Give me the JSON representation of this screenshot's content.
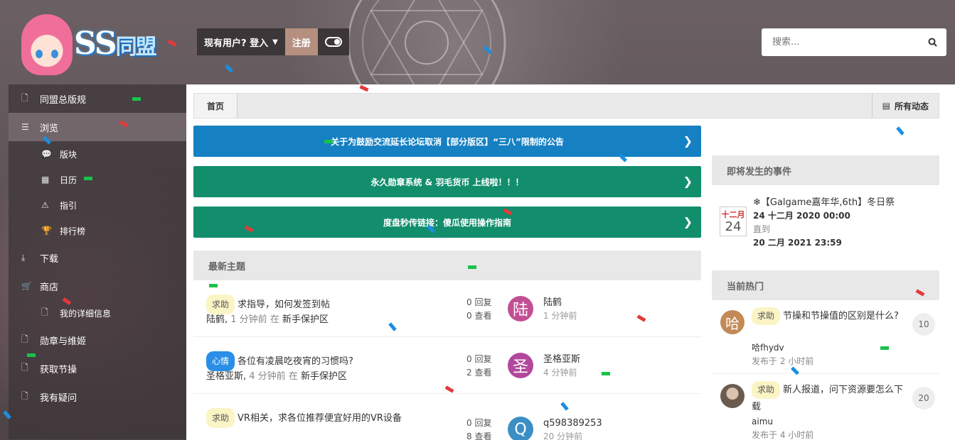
{
  "brand": {
    "logo_text": "SS",
    "logo_subtext": "同盟"
  },
  "header": {
    "login_label": "现有用户? 登入",
    "register_label": "注册",
    "search_placeholder": "搜索..."
  },
  "sidebar": {
    "items": [
      {
        "label": "同盟总版规",
        "icon": "document-icon"
      },
      {
        "label": "浏览",
        "icon": "list-icon"
      },
      {
        "label": "版块",
        "icon": "chat-icon"
      },
      {
        "label": "日历",
        "icon": "calendar-icon"
      },
      {
        "label": "指引",
        "icon": "warning-icon"
      },
      {
        "label": "排行榜",
        "icon": "trophy-icon"
      },
      {
        "label": "下载",
        "icon": "download-icon"
      },
      {
        "label": "商店",
        "icon": "cart-icon"
      },
      {
        "label": "我的详细信息",
        "icon": "document-icon"
      },
      {
        "label": "勋章与维姬",
        "icon": "document-icon"
      },
      {
        "label": "获取节操",
        "icon": "document-icon"
      },
      {
        "label": "我有疑问",
        "icon": "document-icon"
      }
    ]
  },
  "breadcrumb": {
    "home": "首页",
    "all_activity": "所有动态"
  },
  "banners": [
    {
      "text": "关于为鼓励交流延长论坛取消【部分版区】“三八”限制的公告",
      "color": "#1580c2"
    },
    {
      "text": "永久勋章系统 & 羽毛货币 上线啦！！！",
      "color": "#128e6d"
    },
    {
      "text": "度盘秒传链接：傻瓜使用操作指南",
      "color": "#128e6d"
    }
  ],
  "latest": {
    "title": "最新主题",
    "topics": [
      {
        "tag": "求助",
        "tag_type": "help",
        "title": "求指导，如何发签到帖",
        "author": "陆鹤",
        "time": "1 分钟前",
        "in": "在",
        "forum": "新手保护区",
        "replies": "0 回复",
        "views": "0 查看",
        "avatar_char": "陆",
        "avatar_color": "#c24f94",
        "last_user": "陆鹤",
        "last_time": "1 分钟前"
      },
      {
        "tag": "心情",
        "tag_type": "heart",
        "title": "各位有凌晨吃夜宵的习惯吗?",
        "author": "圣格亚斯",
        "time": "4 分钟前",
        "in": "在",
        "forum": "新手保护区",
        "replies": "0 回复",
        "views": "2 查看",
        "avatar_char": "圣",
        "avatar_color": "#b2479c",
        "last_user": "圣格亚斯",
        "last_time": "4 分钟前"
      },
      {
        "tag": "求助",
        "tag_type": "help",
        "title": "VR相关，求各位推荐便宜好用的VR设备",
        "author": "",
        "time": "",
        "in": "",
        "forum": "",
        "replies": "0 回复",
        "views": "8 查看",
        "avatar_char": "Q",
        "avatar_color": "#3b8fc4",
        "last_user": "q598389253",
        "last_time": "20 分钟前"
      }
    ]
  },
  "events": {
    "title": "即将发生的事件",
    "items": [
      {
        "month": "十二月",
        "day": "24",
        "name": "❄【Galgame嘉年华,6th】冬日祭",
        "start": "24 十二月 2020 00:00",
        "until": "直到",
        "end": "20 二月 2021 23:59"
      }
    ]
  },
  "hot": {
    "title": "当前热门",
    "items": [
      {
        "tag": "求助",
        "title": "节操和节操值的区别是什么?",
        "author": "哈fhydv",
        "posted": "发布于 2 小时前",
        "count": "10",
        "avatar_char": "哈",
        "avatar_color": "#c28a56"
      },
      {
        "tag": "求助",
        "title": "新人报道，问下资源要怎么下载",
        "author": "aimu",
        "posted": "发布于 4 小时前",
        "count": "20",
        "avatar_char": "",
        "avatar_color": "#6b5b4f"
      }
    ]
  },
  "colors": {
    "banner_blue": "#1580c2",
    "banner_green": "#128e6d",
    "register": "#b58f80"
  }
}
